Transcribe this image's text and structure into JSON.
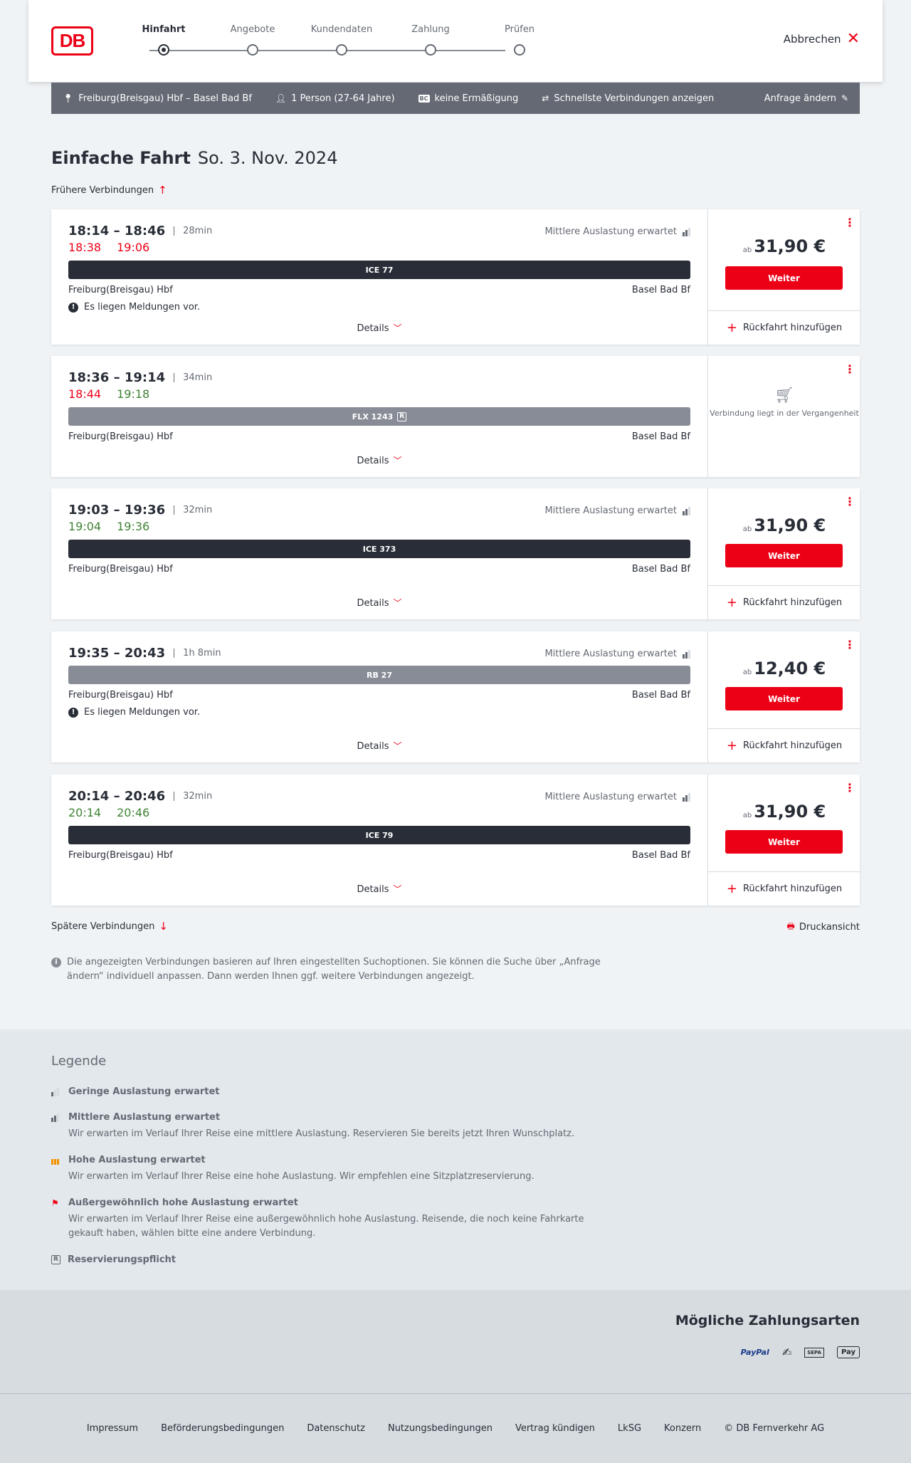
{
  "header": {
    "logo": "DB",
    "steps": [
      {
        "label": "Hinfahrt",
        "active": true
      },
      {
        "label": "Angebote",
        "active": false
      },
      {
        "label": "Kundendaten",
        "active": false
      },
      {
        "label": "Zahlung",
        "active": false
      },
      {
        "label": "Prüfen",
        "active": false
      }
    ],
    "cancel_label": "Abbrechen"
  },
  "summary": {
    "route": "Freiburg(Breisgau) Hbf – Basel Bad Bf",
    "passengers": "1 Person (27-64 Jahre)",
    "discount_badge": "BC",
    "discount": "keine Ermäßigung",
    "fastest": "Schnellste Verbindungen anzeigen",
    "change": "Anfrage ändern"
  },
  "title": {
    "type": "Einfache Fahrt",
    "date": "So. 3. Nov. 2024"
  },
  "earlier_label": "Frühere Verbindungen",
  "later_label": "Spätere Verbindungen",
  "print_label": "Druckansicht",
  "connections": [
    {
      "times": "18:14 – 18:46",
      "duration": "28min",
      "rt_dep": "18:38",
      "rt_arr": "19:06",
      "rt_color": "red",
      "occupancy": "Mittlere Auslastung erwartet",
      "train": "ICE 77",
      "from": "Freiburg(Breisgau) Hbf",
      "to": "Basel Bad Bf",
      "notice": "Es liegen Meldungen vor.",
      "details": "Details",
      "price_prefix": "ab",
      "price": "31,90 €",
      "button": "Weiter",
      "return_label": "Rückfahrt hinzufügen"
    },
    {
      "times": "18:36 – 19:14",
      "duration": "34min",
      "rt_dep": "18:44",
      "rt_arr": "19:18",
      "train": "FLX 1243",
      "train_badge": "R",
      "from": "Freiburg(Breisgau) Hbf",
      "to": "Basel Bad Bf",
      "details": "Details",
      "past_text": "Verbindung liegt in der Vergangenheit"
    },
    {
      "times": "19:03 – 19:36",
      "duration": "32min",
      "rt_dep": "19:04",
      "rt_arr": "19:36",
      "occupancy": "Mittlere Auslastung erwartet",
      "train": "ICE 373",
      "from": "Freiburg(Breisgau) Hbf",
      "to": "Basel Bad Bf",
      "details": "Details",
      "price_prefix": "ab",
      "price": "31,90 €",
      "button": "Weiter",
      "return_label": "Rückfahrt hinzufügen"
    },
    {
      "times": "19:35 – 20:43",
      "duration": "1h 8min",
      "occupancy": "Mittlere Auslastung erwartet",
      "train": "RB 27",
      "from": "Freiburg(Breisgau) Hbf",
      "to": "Basel Bad Bf",
      "notice": "Es liegen Meldungen vor.",
      "details": "Details",
      "price_prefix": "ab",
      "price": "12,40 €",
      "button": "Weiter",
      "return_label": "Rückfahrt hinzufügen"
    },
    {
      "times": "20:14 – 20:46",
      "duration": "32min",
      "rt_dep": "20:14",
      "rt_arr": "20:46",
      "occupancy": "Mittlere Auslastung erwartet",
      "train": "ICE 79",
      "from": "Freiburg(Breisgau) Hbf",
      "to": "Basel Bad Bf",
      "details": "Details",
      "price_prefix": "ab",
      "price": "31,90 €",
      "button": "Weiter",
      "return_label": "Rückfahrt hinzufügen"
    }
  ],
  "info_text": "Die angezeigten Verbindungen basieren auf Ihren eingestellten Suchoptionen. Sie können die Suche über „Anfrage ändern“ individuell anpassen. Dann werden Ihnen ggf. weitere Verbindungen angezeigt.",
  "legend": {
    "title": "Legende",
    "items": [
      {
        "head": "Geringe Auslastung erwartet",
        "desc": ""
      },
      {
        "head": "Mittlere Auslastung erwartet",
        "desc": "Wir erwarten im Verlauf Ihrer Reise eine mittlere Auslastung. Reservieren Sie bereits jetzt Ihren Wunschplatz."
      },
      {
        "head": "Hohe Auslastung erwartet",
        "desc": "Wir erwarten im Verlauf Ihrer Reise eine hohe Auslastung. Wir empfehlen eine Sitzplatzreservierung."
      },
      {
        "head": "Außergewöhnlich hohe Auslastung erwartet",
        "desc": "Wir erwarten im Verlauf Ihrer Reise eine außergewöhnlich hohe Auslastung. Reisende, die noch keine Fahrkarte gekauft haben, wählen bitte eine andere Verbindung."
      },
      {
        "head": "Reservierungspflicht",
        "desc": ""
      }
    ]
  },
  "payment": {
    "title": "Mögliche Zahlungsarten",
    "methods": [
      "PayPal",
      "SEPA",
      "Pay"
    ]
  },
  "footer": {
    "links": [
      "Impressum",
      "Beförderungsbedingungen",
      "Datenschutz",
      "Nutzungsbedingungen",
      "Vertrag kündigen",
      "LkSG",
      "Konzern",
      "© DB Fernverkehr AG"
    ]
  },
  "colors": {
    "brand_red": "#ec0016",
    "realtime_green": "#408335",
    "dark": "#282d37",
    "occupancy_high": "#f39200"
  }
}
